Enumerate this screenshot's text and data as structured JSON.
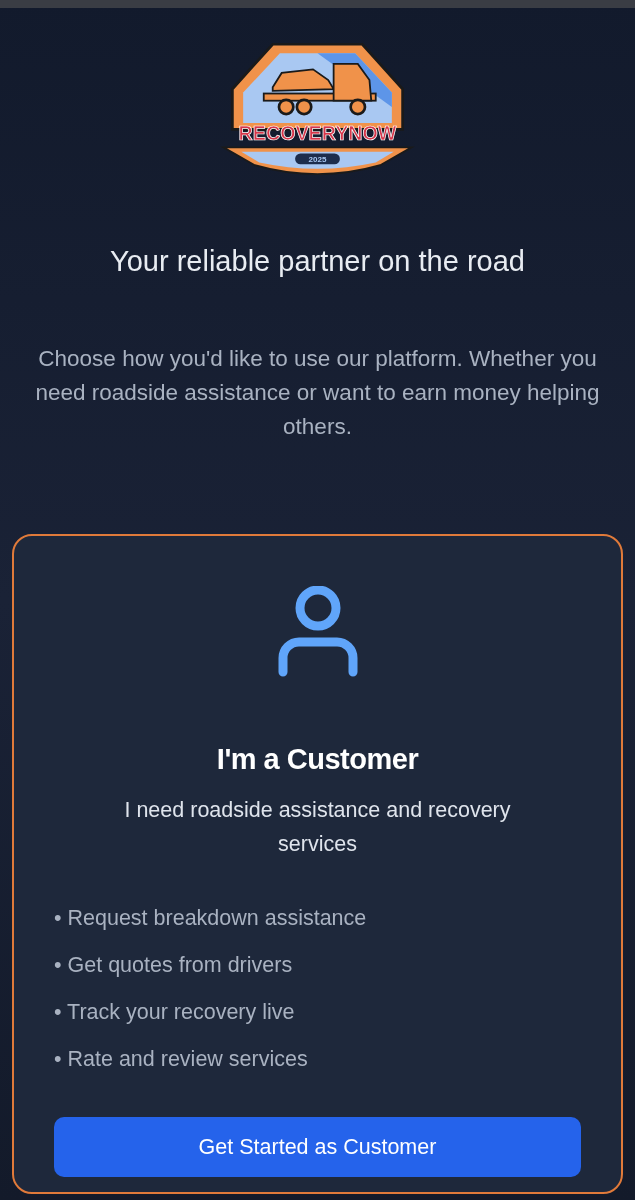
{
  "logo": {
    "name": "RECOVERYNOW",
    "year": "2025"
  },
  "tagline": "Your reliable partner on the road",
  "description": "Choose how you'd like to use our platform. Whether you need roadside assistance or want to earn money helping others.",
  "role_card": {
    "title": "I'm a Customer",
    "subtitle": "I need roadside assistance and recovery services",
    "features": [
      "• Request breakdown assistance",
      "• Get quotes from drivers",
      "• Track your recovery live",
      "• Rate and review services"
    ],
    "button": "Get Started as Customer"
  }
}
